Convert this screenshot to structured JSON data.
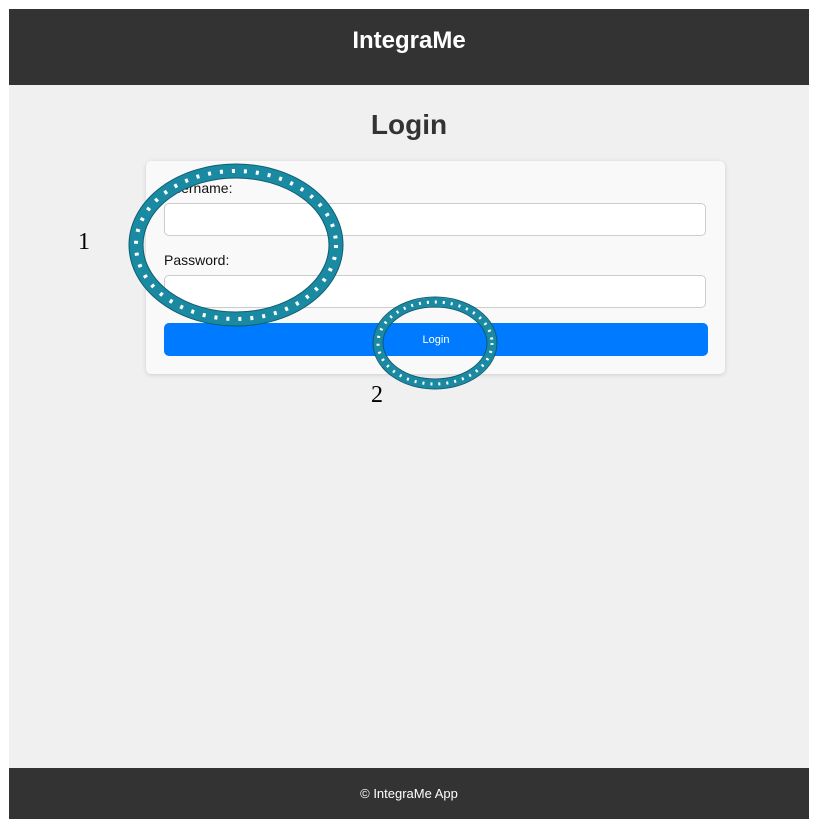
{
  "header": {
    "title": "IntegraMe"
  },
  "page": {
    "title": "Login"
  },
  "form": {
    "username_label": "Username:",
    "username_value": "",
    "password_label": "Password:",
    "password_value": "",
    "submit_label": "Login"
  },
  "footer": {
    "text": "© IntegraMe App"
  },
  "annotations": {
    "marker_1": "1",
    "marker_2": "2",
    "ring_color": "#1a8aa3"
  },
  "colors": {
    "header_bg": "#333333",
    "page_bg": "#f0f0f0",
    "button_bg": "#007bff"
  }
}
